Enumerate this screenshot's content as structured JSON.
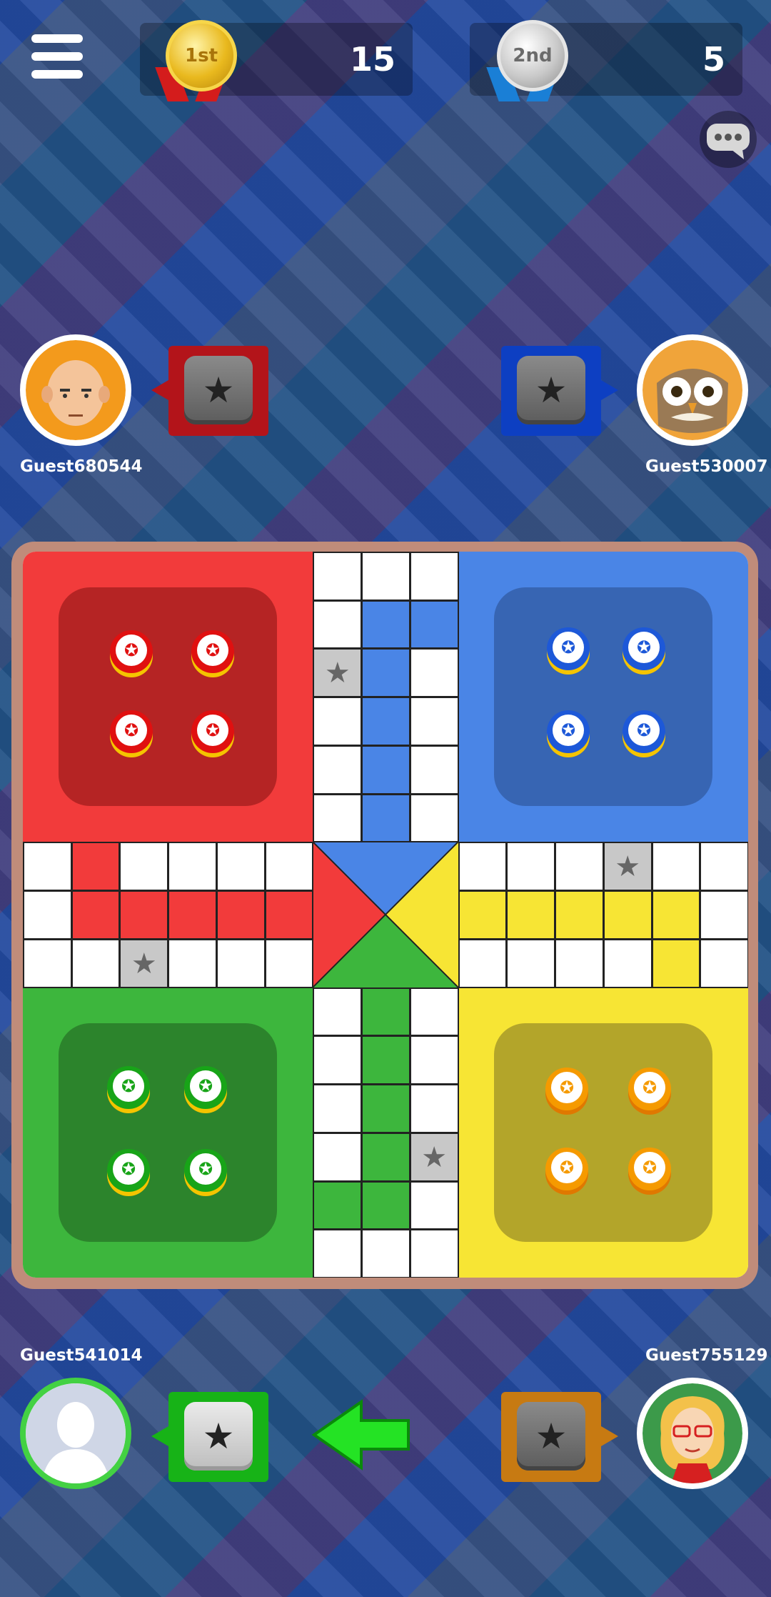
{
  "scoreboard": {
    "first": {
      "medal_text": "1st",
      "score": "15"
    },
    "second": {
      "medal_text": "2nd",
      "score": "5"
    }
  },
  "icons": {
    "menu": "hamburger-menu-icon",
    "chat": "chat-bubble-icon",
    "dice": "star-dice-icon",
    "safe_cell": "star-icon",
    "turn_arrow": "green-arrow-icon"
  },
  "players": {
    "top_left": {
      "name": "Guest680544",
      "color": "#d32f2f",
      "avatar": "bald-man-avatar"
    },
    "top_right": {
      "name": "Guest530007",
      "color": "#1e4fcc",
      "avatar": "owl-avatar"
    },
    "bottom_left": {
      "name": "Guest541014",
      "color": "#2db52d",
      "avatar": "default-silhouette-avatar"
    },
    "bottom_right": {
      "name": "Guest755129",
      "color": "#d98a00",
      "avatar": "woman-glasses-avatar"
    }
  },
  "colors": {
    "red": "#f23b3b",
    "blue": "#4a85e6",
    "green": "#3db63d",
    "yellow": "#f7e534",
    "frame": "#c08c7a"
  },
  "dice_symbol": "★",
  "token_symbol": "✪"
}
